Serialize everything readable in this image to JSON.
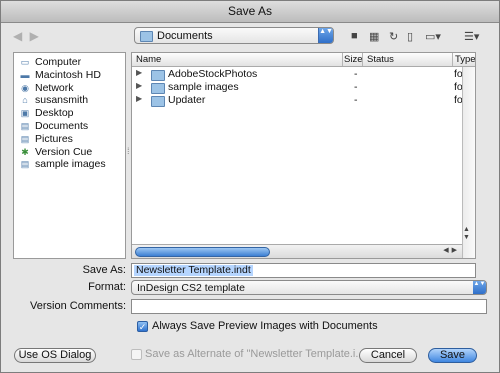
{
  "window": {
    "title": "Save As"
  },
  "toolbar": {
    "back_forward": "◀ ▶",
    "location": "Documents",
    "location_arrows": "▲▼",
    "icons": {
      "new_folder": "■",
      "folder": "▦",
      "refresh": "↻",
      "trash": "▯",
      "actions": "▭▾",
      "view": "☰▾"
    }
  },
  "sidebar": {
    "items": [
      {
        "label": "Computer",
        "icon": "computer-icon",
        "glyph": "▭"
      },
      {
        "label": "Macintosh HD",
        "icon": "hard-drive-icon",
        "glyph": "▬"
      },
      {
        "label": "Network",
        "icon": "network-icon",
        "glyph": "◉"
      },
      {
        "label": "susansmith",
        "icon": "home-icon",
        "glyph": "⌂"
      },
      {
        "label": "Desktop",
        "icon": "desktop-icon",
        "glyph": "▣"
      },
      {
        "label": "Documents",
        "icon": "folder-icon",
        "glyph": "▤"
      },
      {
        "label": "Pictures",
        "icon": "folder-icon",
        "glyph": "▤"
      },
      {
        "label": "Version Cue",
        "icon": "version-cue-icon",
        "glyph": "✱"
      },
      {
        "label": "sample images",
        "icon": "folder-icon",
        "glyph": "▤"
      }
    ]
  },
  "browser": {
    "columns": {
      "name": "Name",
      "size": "Size",
      "status": "Status",
      "type": "Type"
    },
    "rows": [
      {
        "name": "AdobeStockPhotos",
        "size": "-",
        "type": "folde"
      },
      {
        "name": "sample images",
        "size": "-",
        "type": "folde"
      },
      {
        "name": "Updater",
        "size": "-",
        "type": "folde"
      }
    ],
    "expand_glyph": "▶",
    "h_arrows": "◀▶",
    "v_arrows": "▲ ▼"
  },
  "form": {
    "save_as_label": "Save As:",
    "save_as_value": "Newsletter Template.indt",
    "format_label": "Format:",
    "format_value": "InDesign CS2 template",
    "format_arrows": "▲▼",
    "version_comments_label": "Version Comments:",
    "version_comments_value": "",
    "preview_checkbox_label": "Always Save Preview Images with Documents",
    "alternate_checkbox_label": "Save as Alternate of \"Newsletter Template.i...",
    "check_glyph": "✓"
  },
  "buttons": {
    "os_dialog": "Use OS Dialog",
    "cancel": "Cancel",
    "save": "Save"
  }
}
